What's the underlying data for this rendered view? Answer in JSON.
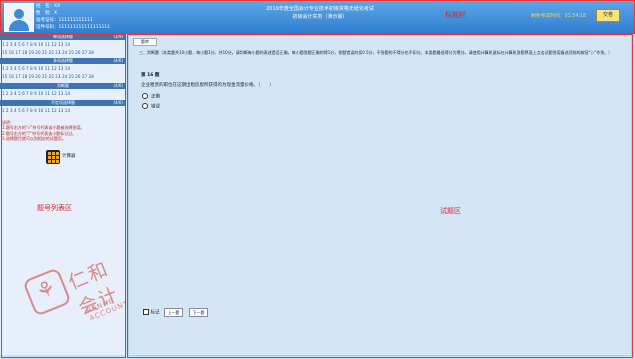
{
  "header": {
    "candidate": {
      "name_line": "姓　名：XX",
      "gender_line": "性　别：X",
      "exam_id_line": "准考证号：111111111111",
      "cert_id_line": "证件号码：111111111111111111"
    },
    "exam_title_lines": [
      "2019年度全国会计专业技术初级资格无纸化考试",
      "初级会计实务（演示版）"
    ],
    "region_label": "标题栏",
    "timer_text": "剩余考试时间：01:54:18",
    "submit_label": "交卷"
  },
  "sidebar": {
    "sections": [
      {
        "title": "单项选择题",
        "count": "(3/9)",
        "rows": [
          "1 2 3 4 5 6 7 8 9 10 11 12 13 14",
          "15 16 17 18 19 20 21 22 23 24 25 26 27 28"
        ]
      },
      {
        "title": "多项选择题",
        "count": "(4/6)",
        "rows": [
          "1 2 3 4 5 6 7 8 9 10 11 12 13 14",
          "15 16 17 18 19 20 21 22 23 24 25 26 27 28"
        ]
      },
      {
        "title": "判断题",
        "count": "(4/6)",
        "rows": [
          "1 2 3 4 5 6 7 8 9 10 11 12 13 14"
        ]
      },
      {
        "title": "不定项选择题",
        "count": "(4/6)",
        "rows": [
          "1 2 3 4 5 6 7 8 9 10 11 12 13 14"
        ]
      }
    ],
    "notice_lines": [
      "说明：",
      "1.题号右方的“√”符号代表该小题被选择答案。",
      "2.题号右方的“?”符号代表该小题标记过。",
      "3.选择题目就可以到相应的试题页。"
    ],
    "calculator_label": "计算器",
    "region_label": "题号列表区"
  },
  "watermark": {
    "cn": "仁和会计",
    "en": "RENHE ACCOUNTANCY"
  },
  "main": {
    "tab_label": "题库",
    "instructions": "三、判断题（本类题共10小题，每小题1分，共10分。请判断每小题的表述是否正确。每小题答题正确的得1分，答题错误的扣0.5分，不答题的不得分也不扣分。本类题最低得分为零分。请使用计算机鼠标在计算机答题界面上点击试题答案备选项前的按钮“○”作答。）",
    "question_number": "第 16 题",
    "question_text": "企业租赁的职位在这期出租房屋所获得的为现金流量价格。（　　）",
    "options": [
      "正确",
      "错误"
    ],
    "region_label": "试题区",
    "mark_label": "标记",
    "prev_label": "上一题",
    "next_label": "下一题"
  },
  "colors": {
    "header_blue": "#2f7fd1",
    "frame_red": "#e33333",
    "sidebar_head": "#3e73b5",
    "timer_yellow": "#ffd84a"
  }
}
